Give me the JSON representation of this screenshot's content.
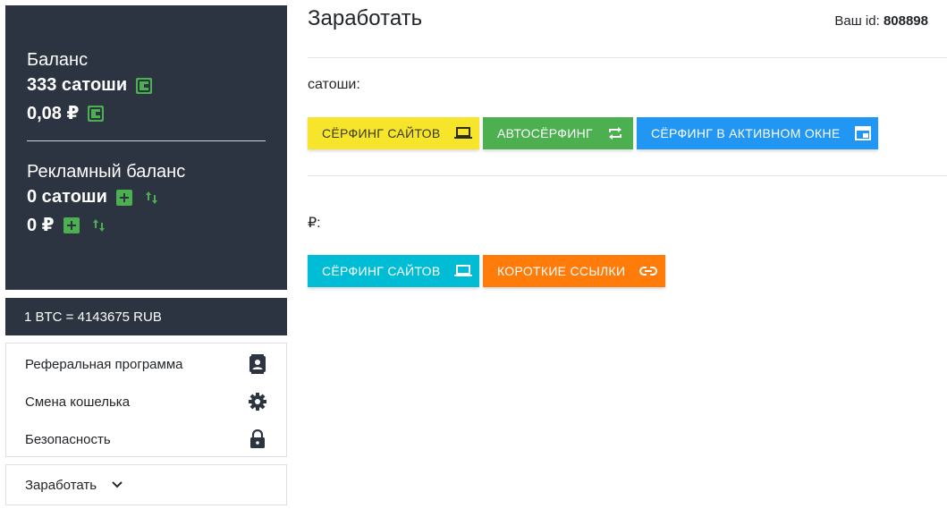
{
  "sidebar": {
    "balance_title": "Баланс",
    "balance_sat": "333 сатоши",
    "balance_rub": "0,08 ₽",
    "ad_balance_title": "Рекламный баланс",
    "ad_balance_sat": "0 сатоши",
    "ad_balance_rub": "0 ₽",
    "rate": "1 BTC = 4143675 RUB",
    "menu": [
      {
        "label": "Реферальная программа",
        "icon": "contacts-icon"
      },
      {
        "label": "Смена кошелька",
        "icon": "gear-icon"
      },
      {
        "label": "Безопасность",
        "icon": "lock-icon"
      }
    ],
    "earn_dropdown": "Заработать"
  },
  "main": {
    "title": "Заработать",
    "user_id_label": "Ваш id:",
    "user_id": "808898",
    "sat_section": {
      "label": "сатоши:",
      "buttons": [
        {
          "label": "Сёрфинг сайтов",
          "icon": "laptop-icon"
        },
        {
          "label": "Автосёрфинг",
          "icon": "repeat-icon"
        },
        {
          "label": "Сёрфинг в активном окне",
          "icon": "window-icon"
        }
      ]
    },
    "rub_section": {
      "label": "₽:",
      "buttons": [
        {
          "label": "Сёрфинг сайтов",
          "icon": "laptop-icon"
        },
        {
          "label": "Короткие ссылки",
          "icon": "link-icon"
        }
      ]
    }
  },
  "colors": {
    "sidebar_bg": "#2d3441",
    "accent_green": "#4caf50",
    "yellow": "#f7e52b",
    "blue": "#2196f3",
    "cyan": "#00bcd4",
    "orange": "#ff7b0a"
  }
}
